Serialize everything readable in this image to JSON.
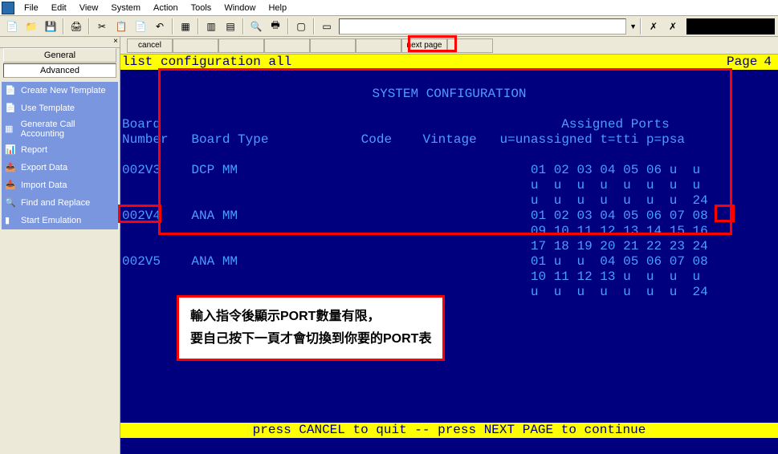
{
  "menu": {
    "file": "File",
    "edit": "Edit",
    "view": "View",
    "system": "System",
    "action": "Action",
    "tools": "Tools",
    "window": "Window",
    "help": "Help"
  },
  "sidebar": {
    "tabs": {
      "general": "General",
      "advanced": "Advanced"
    },
    "items": [
      {
        "label": "Create New Template"
      },
      {
        "label": "Use Template"
      },
      {
        "label": "Generate Call Accounting"
      },
      {
        "label": "Report"
      },
      {
        "label": "Export Data"
      },
      {
        "label": "Import Data"
      },
      {
        "label": "Find and Replace"
      },
      {
        "label": "Start Emulation"
      }
    ]
  },
  "term_buttons": {
    "cancel": "cancel",
    "nextpage": "next page"
  },
  "cmd": {
    "text": "list configuration all",
    "page_label": "Page",
    "page_num": "4"
  },
  "term": {
    "title": "SYSTEM CONFIGURATION",
    "hdr1_board": "Board",
    "hdr1_assigned": "Assigned Ports",
    "hdr2_number": "Number",
    "hdr2_type": "Board Type",
    "hdr2_code": "Code",
    "hdr2_vintage": "Vintage",
    "hdr2_ports": "u=unassigned t=tti p=psa",
    "r1a": "002V3    DCP MM                                      01 02 03 04 05 06 u  u",
    "r1b": "                                                     u  u  u  u  u  u  u  u",
    "r1c": "                                                     u  u  u  u  u  u  u  24",
    "r2a": "002V4    ANA MM                                      01 02 03 04 05 06 07 08",
    "r2b": "                                                     09 10 11 12 13 14 15 16",
    "r2c": "                                                     17 18 19 20 21 22 23 24",
    "r3a": "002V5    ANA MM                                      01 u  u  04 05 06 07 08",
    "r3b": "                                                     10 11 12 13 u  u  u  u",
    "r3c": "                                                     u  u  u  u  u  u  u  24",
    "footer": "press CANCEL to quit --  press NEXT PAGE to continue"
  },
  "annotation": {
    "line1": "輸入指令後顯示PORT數量有限，",
    "line2": "要自己按下一頁才會切換到你要的PORT表"
  }
}
